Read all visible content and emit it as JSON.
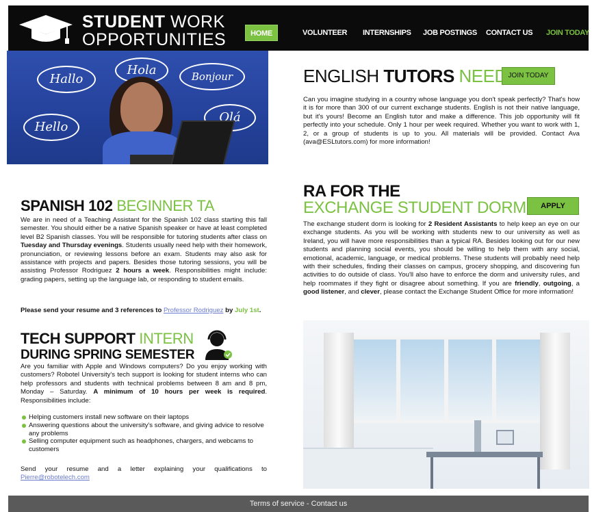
{
  "header": {
    "logo_line1_bold": "STUDENT",
    "logo_line1_rest": " WORK",
    "logo_line2": "OPPORTUNITIES",
    "nav": {
      "home": "HOME",
      "volunteer": "VOLUNTEER",
      "internships": "INTERNSHIPS",
      "job_postings": "JOB POSTINGS",
      "contact_us": "CONTACT US",
      "join_today": "JOIN TODAY"
    }
  },
  "hero": {
    "bubbles": [
      "Hallo",
      "Hola",
      "Bonjour",
      "Hello",
      "Olá"
    ]
  },
  "spanish": {
    "title_bold": "SPANISH 102",
    "title_green": "BEGINNER TA",
    "body_1": "We are in need of a Teaching Assistant for the Spanish 102 class starting this fall semester. You should either be a native Spanish speaker or have at least completed level B2 Spanish classes. You will be responsible for tutoring students after class on ",
    "body_bold_1": "Tuesday and Thursday evenings",
    "body_2": ". Students usually need help with their homework, pronunciation, or reviewing lessons before an exam. Students may also ask for assistance with projects and papers. Besides those tutoring sessions, you will be assisting Professor Rodriguez ",
    "body_bold_2": "2 hours a week",
    "body_3": ". Responsibilities might include: grading papers, setting up the language lab, or responding to student emails.",
    "cta_1": "Please send your resume and 3 references to ",
    "cta_link": "Professor Rodriguez",
    "cta_2": " by ",
    "cta_date": "July 1st",
    "cta_end": "."
  },
  "tech": {
    "title_bold": "TECH SUPPORT",
    "title_green": "INTERN",
    "title_line2": "DURING SPRING SEMESTER",
    "body_1": "Are you familiar with Apple and Windows computers? Do you enjoy working with customers? Robotel University's tech support is looking for student interns who can help professors and students with technical problems between 8 am and 8 pm, Monday – Saturday. ",
    "body_bold": "A minimum of 10 hours per week is required",
    "body_2": ". Responsibilities include:",
    "bullets": [
      "Helping customers install new software on their laptops",
      "Answering questions about the university's software, and giving advice to resolve any problems",
      "Selling computer equipment such as headphones, chargers, and webcams to customers"
    ],
    "footer_text": "Send your resume and a letter explaining your qualifications to ",
    "email": "Pierre@robotelech.com"
  },
  "english": {
    "title_light": "ENGLISH ",
    "title_bold": "TUTORS",
    "title_green": " NEEDED",
    "button": "JOIN TODAY",
    "body": "Can you imagine studying in a country whose language you don't speak perfectly? That's how it is for more than 300 of our current exchange students. English is not their native language, but it's yours! Become an English tutor and make a difference. This job opportunity will fit perfectly into your schedule. Only 1 hour per week required. Whether you want to work with 1, 2, or a group of students is up to you. All materials will be provided. Contact Ava (ava@ESLtutors.com) for more information!"
  },
  "ra": {
    "title_line1": "RA FOR THE",
    "title_line2": "EXCHANGE STUDENT DORM",
    "button": "APPLY",
    "body_1": "The exchange student dorm is looking for ",
    "body_bold_1": "2 Resident Assistants",
    "body_2": " to help keep an eye on our exchange students. As you will be working with students new to our university as well as Ireland, you will have more responsibilities than a typical RA. Besides looking out for our new students and planning social events, you should be willing to help them with any social, emotional, academic, language, or medical problems. These students will probably need help with their schedules, finding their classes on campus, grocery shopping, and discovering fun activities to do outside of class. You'll also have to enforce the dorm and university rules, and help roommates if they fight or disagree about something. If you are ",
    "body_bold_2": "friendly",
    "body_3": ", ",
    "body_bold_3": "outgoing",
    "body_4": ", a ",
    "body_bold_4": "good listener",
    "body_5": ", and ",
    "body_bold_5": "clever",
    "body_6": ", please contact the Exchange Student Office for more information!"
  },
  "footer": {
    "terms": "Terms of service",
    "sep": " - ",
    "contact": "Contact us"
  },
  "colors": {
    "accent_green": "#7bc142",
    "header_bg": "#0b0b0b",
    "footer_bg": "#5a5a5a"
  }
}
